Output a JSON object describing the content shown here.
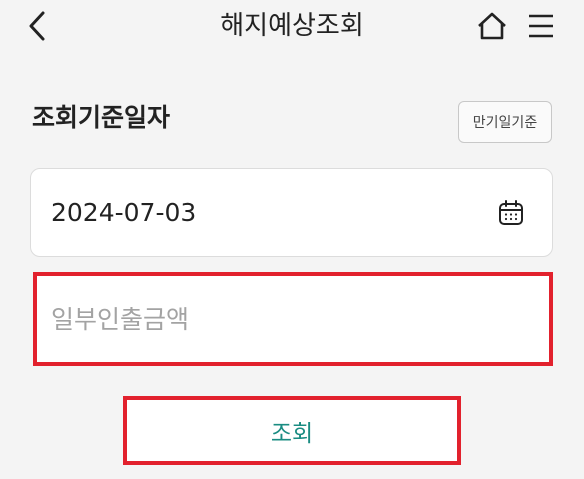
{
  "header": {
    "title": "해지예상조회",
    "back_icon": "chevron-left-icon",
    "home_icon": "home-icon",
    "menu_icon": "hamburger-menu-icon"
  },
  "form": {
    "section_label": "조회기준일자",
    "maturity_button_label": "만기일기준",
    "date_value": "2024-07-03",
    "calendar_icon": "calendar-icon",
    "amount_placeholder": "일부인출금액",
    "amount_value": "",
    "submit_label": "조회"
  },
  "colors": {
    "background": "#f4f4f4",
    "highlight_border": "#e2212d",
    "submit_text": "#1a8c82",
    "placeholder_text": "#a3a3a3"
  }
}
